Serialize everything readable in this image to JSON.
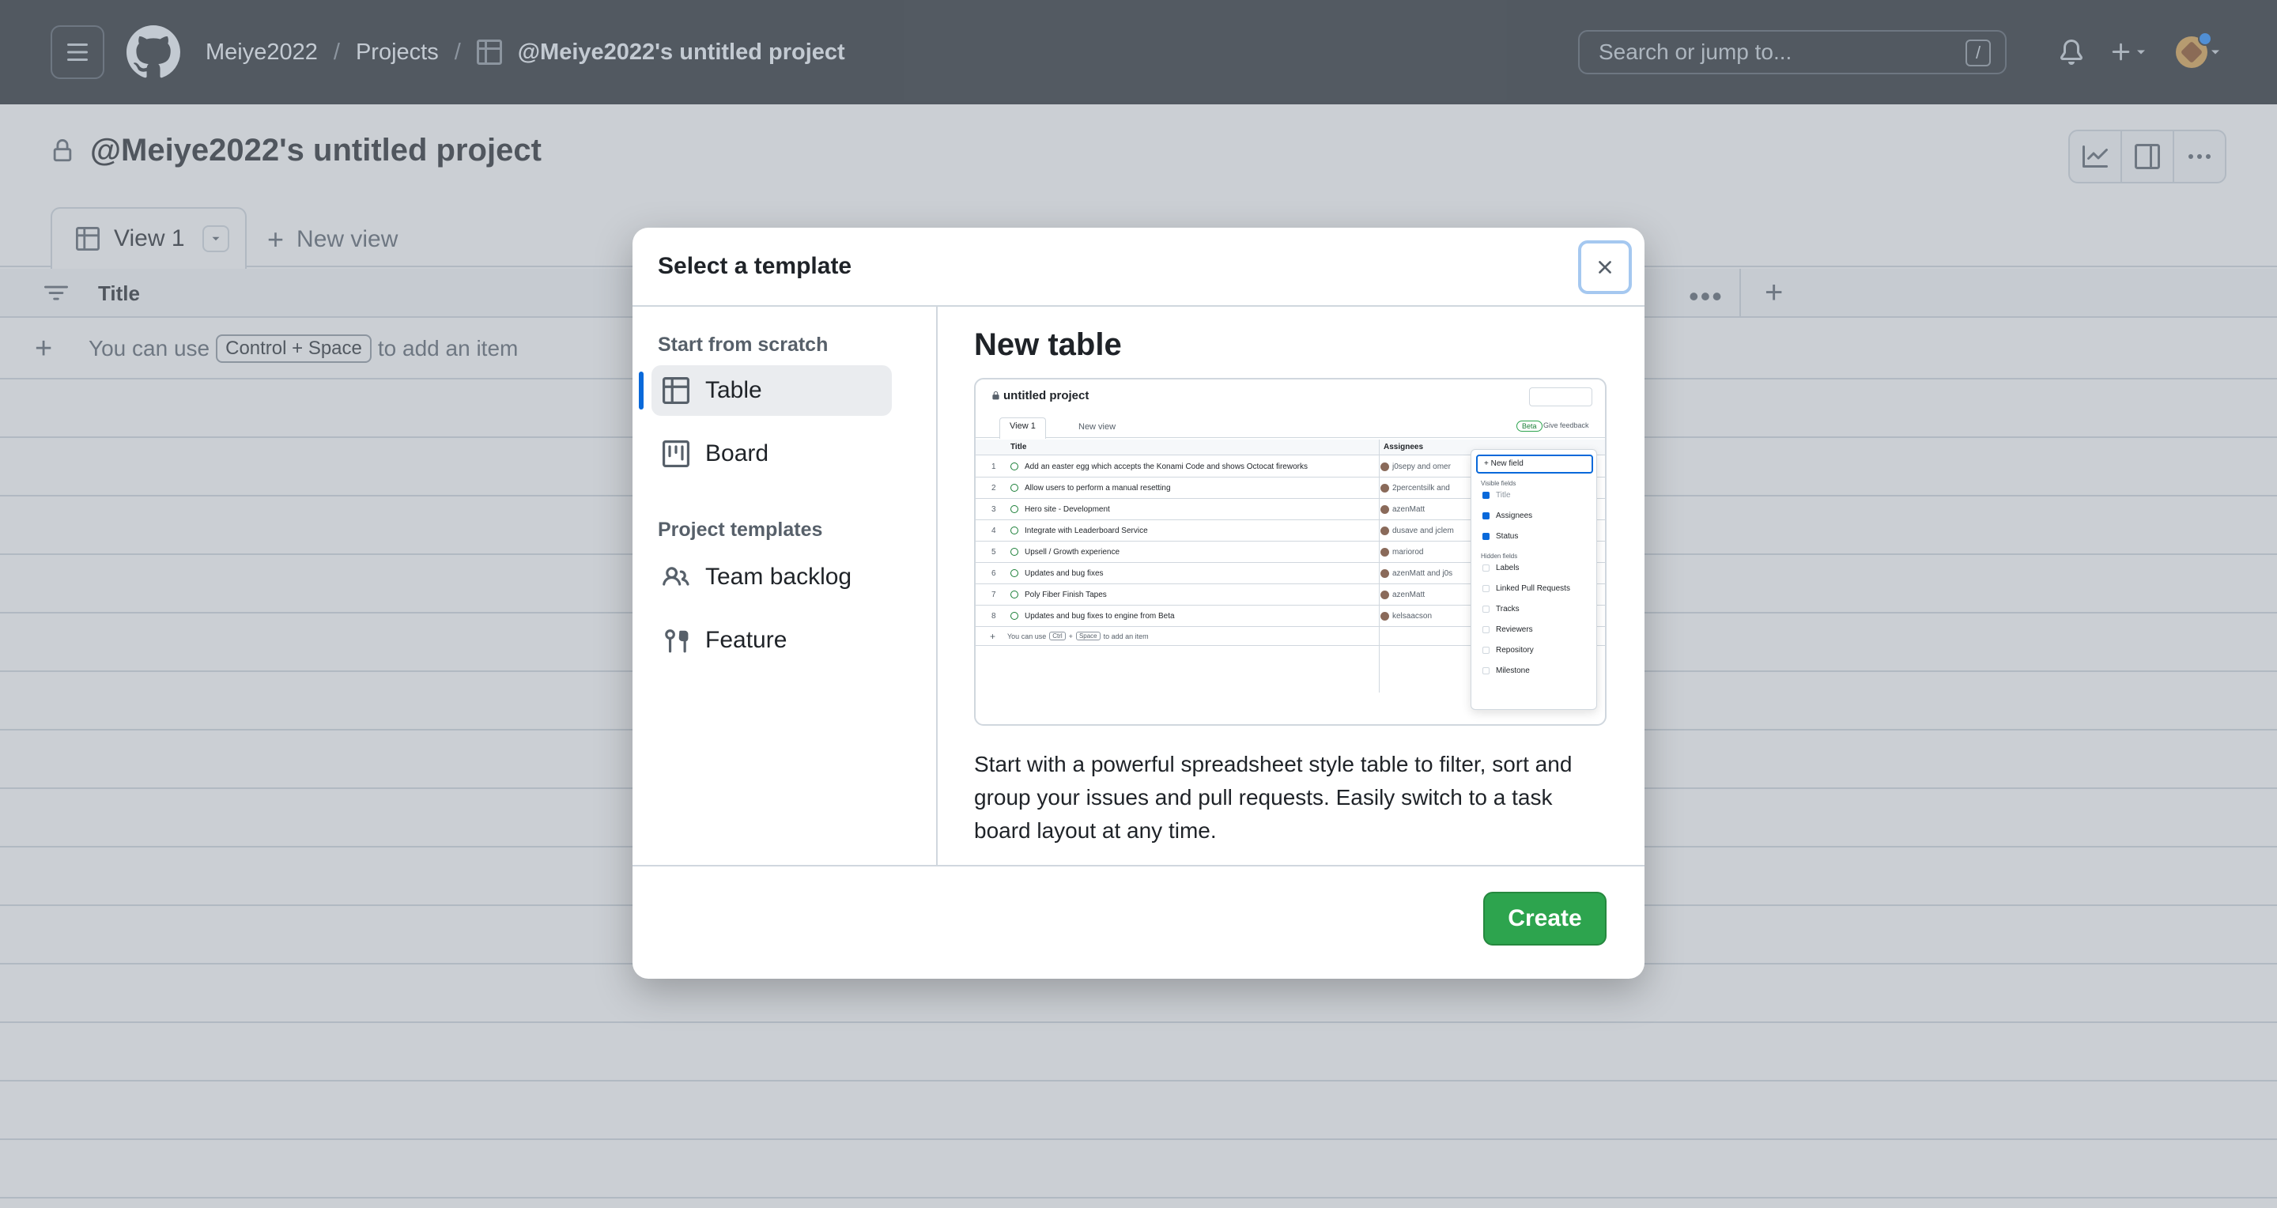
{
  "header": {
    "owner": "Meiye2022",
    "breadcrumb_projects": "Projects",
    "project_name": "@Meiye2022's untitled project",
    "search_placeholder": "Search or jump to...",
    "search_shortcut": "/"
  },
  "page": {
    "title": "@Meiye2022's untitled project",
    "tabs": [
      {
        "label": "View 1"
      }
    ],
    "new_view_label": "New view",
    "column_title": "Title",
    "add_item": {
      "prefix": "You can use",
      "key1": "Control + Space",
      "suffix": "to add an item"
    }
  },
  "dialog": {
    "title": "Select a template",
    "scratch_heading": "Start from scratch",
    "scratch_options": [
      {
        "label": "Table",
        "icon": "table-icon",
        "selected": true
      },
      {
        "label": "Board",
        "icon": "board-icon",
        "selected": false
      }
    ],
    "templates_heading": "Project templates",
    "template_options": [
      {
        "label": "Team backlog",
        "icon": "people-icon"
      },
      {
        "label": "Feature",
        "icon": "feature-icon"
      }
    ],
    "main_title": "New table",
    "description": "Start with a powerful spreadsheet style table to filter, sort and group your issues and pull requests. Easily switch to a task board layout at any time.",
    "create_label": "Create",
    "preview": {
      "title": "untitled project",
      "tab": "View 1",
      "new_view": "New view",
      "beta": "Beta",
      "feedback": "Give feedback",
      "col_title": "Title",
      "col_assignees": "Assignees",
      "rows": [
        {
          "n": "1",
          "title": "Add an easter egg which accepts the Konami Code and shows Octocat fireworks",
          "assignee": "j0sepy and omer"
        },
        {
          "n": "2",
          "title": "Allow users to perform a manual resetting",
          "assignee": "2percentsilk and"
        },
        {
          "n": "3",
          "title": "Hero site - Development",
          "assignee": "azenMatt"
        },
        {
          "n": "4",
          "title": "Integrate with Leaderboard Service",
          "assignee": "dusave and jclem"
        },
        {
          "n": "5",
          "title": "Upsell / Growth experience",
          "assignee": "mariorod"
        },
        {
          "n": "6",
          "title": "Updates and bug fixes",
          "assignee": "azenMatt and j0s"
        },
        {
          "n": "7",
          "title": "Poly Fiber Finish Tapes",
          "assignee": "azenMatt"
        },
        {
          "n": "8",
          "title": "Updates and bug fixes to engine from Beta",
          "assignee": "kelsaacson"
        }
      ],
      "add_prefix": "You can use",
      "add_key1": "Ctrl",
      "add_key2": "Space",
      "add_suffix": "to add an item",
      "menu": {
        "new_field": "New field",
        "visible_heading": "Visible fields",
        "visible": [
          "Title",
          "Assignees",
          "Status"
        ],
        "hidden_heading": "Hidden fields",
        "hidden": [
          "Labels",
          "Linked Pull Requests",
          "Tracks",
          "Reviewers",
          "Repository",
          "Milestone"
        ]
      }
    }
  },
  "colors": {
    "header_bg": "#24292f",
    "accent": "#0969da",
    "create_green": "#2da44e"
  }
}
